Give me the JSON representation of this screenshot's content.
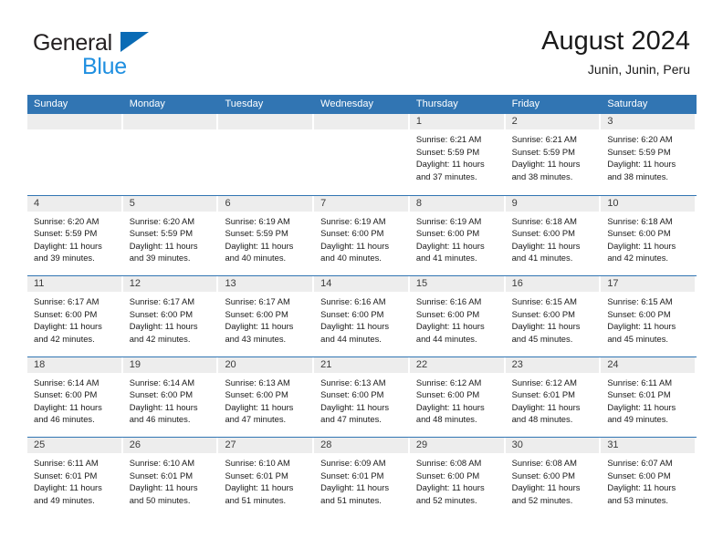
{
  "brand": {
    "name_part1": "General",
    "name_part2": "Blue",
    "logo_icon": "triangle-logo-icon"
  },
  "header": {
    "title": "August 2024",
    "subtitle": "Junin, Junin, Peru"
  },
  "colors": {
    "header_blue": "#3175b3",
    "brand_blue": "#1f8fe0",
    "logo_blue": "#0a6bb5",
    "day_band_gray": "#ededed"
  },
  "calendar": {
    "day_headers": [
      "Sunday",
      "Monday",
      "Tuesday",
      "Wednesday",
      "Thursday",
      "Friday",
      "Saturday"
    ],
    "weeks": [
      [
        {
          "day": "",
          "empty": true
        },
        {
          "day": "",
          "empty": true
        },
        {
          "day": "",
          "empty": true
        },
        {
          "day": "",
          "empty": true
        },
        {
          "day": "1",
          "sunrise": "Sunrise: 6:21 AM",
          "sunset": "Sunset: 5:59 PM",
          "daylight_line1": "Daylight: 11 hours",
          "daylight_line2": "and 37 minutes."
        },
        {
          "day": "2",
          "sunrise": "Sunrise: 6:21 AM",
          "sunset": "Sunset: 5:59 PM",
          "daylight_line1": "Daylight: 11 hours",
          "daylight_line2": "and 38 minutes."
        },
        {
          "day": "3",
          "sunrise": "Sunrise: 6:20 AM",
          "sunset": "Sunset: 5:59 PM",
          "daylight_line1": "Daylight: 11 hours",
          "daylight_line2": "and 38 minutes."
        }
      ],
      [
        {
          "day": "4",
          "sunrise": "Sunrise: 6:20 AM",
          "sunset": "Sunset: 5:59 PM",
          "daylight_line1": "Daylight: 11 hours",
          "daylight_line2": "and 39 minutes."
        },
        {
          "day": "5",
          "sunrise": "Sunrise: 6:20 AM",
          "sunset": "Sunset: 5:59 PM",
          "daylight_line1": "Daylight: 11 hours",
          "daylight_line2": "and 39 minutes."
        },
        {
          "day": "6",
          "sunrise": "Sunrise: 6:19 AM",
          "sunset": "Sunset: 5:59 PM",
          "daylight_line1": "Daylight: 11 hours",
          "daylight_line2": "and 40 minutes."
        },
        {
          "day": "7",
          "sunrise": "Sunrise: 6:19 AM",
          "sunset": "Sunset: 6:00 PM",
          "daylight_line1": "Daylight: 11 hours",
          "daylight_line2": "and 40 minutes."
        },
        {
          "day": "8",
          "sunrise": "Sunrise: 6:19 AM",
          "sunset": "Sunset: 6:00 PM",
          "daylight_line1": "Daylight: 11 hours",
          "daylight_line2": "and 41 minutes."
        },
        {
          "day": "9",
          "sunrise": "Sunrise: 6:18 AM",
          "sunset": "Sunset: 6:00 PM",
          "daylight_line1": "Daylight: 11 hours",
          "daylight_line2": "and 41 minutes."
        },
        {
          "day": "10",
          "sunrise": "Sunrise: 6:18 AM",
          "sunset": "Sunset: 6:00 PM",
          "daylight_line1": "Daylight: 11 hours",
          "daylight_line2": "and 42 minutes."
        }
      ],
      [
        {
          "day": "11",
          "sunrise": "Sunrise: 6:17 AM",
          "sunset": "Sunset: 6:00 PM",
          "daylight_line1": "Daylight: 11 hours",
          "daylight_line2": "and 42 minutes."
        },
        {
          "day": "12",
          "sunrise": "Sunrise: 6:17 AM",
          "sunset": "Sunset: 6:00 PM",
          "daylight_line1": "Daylight: 11 hours",
          "daylight_line2": "and 42 minutes."
        },
        {
          "day": "13",
          "sunrise": "Sunrise: 6:17 AM",
          "sunset": "Sunset: 6:00 PM",
          "daylight_line1": "Daylight: 11 hours",
          "daylight_line2": "and 43 minutes."
        },
        {
          "day": "14",
          "sunrise": "Sunrise: 6:16 AM",
          "sunset": "Sunset: 6:00 PM",
          "daylight_line1": "Daylight: 11 hours",
          "daylight_line2": "and 44 minutes."
        },
        {
          "day": "15",
          "sunrise": "Sunrise: 6:16 AM",
          "sunset": "Sunset: 6:00 PM",
          "daylight_line1": "Daylight: 11 hours",
          "daylight_line2": "and 44 minutes."
        },
        {
          "day": "16",
          "sunrise": "Sunrise: 6:15 AM",
          "sunset": "Sunset: 6:00 PM",
          "daylight_line1": "Daylight: 11 hours",
          "daylight_line2": "and 45 minutes."
        },
        {
          "day": "17",
          "sunrise": "Sunrise: 6:15 AM",
          "sunset": "Sunset: 6:00 PM",
          "daylight_line1": "Daylight: 11 hours",
          "daylight_line2": "and 45 minutes."
        }
      ],
      [
        {
          "day": "18",
          "sunrise": "Sunrise: 6:14 AM",
          "sunset": "Sunset: 6:00 PM",
          "daylight_line1": "Daylight: 11 hours",
          "daylight_line2": "and 46 minutes."
        },
        {
          "day": "19",
          "sunrise": "Sunrise: 6:14 AM",
          "sunset": "Sunset: 6:00 PM",
          "daylight_line1": "Daylight: 11 hours",
          "daylight_line2": "and 46 minutes."
        },
        {
          "day": "20",
          "sunrise": "Sunrise: 6:13 AM",
          "sunset": "Sunset: 6:00 PM",
          "daylight_line1": "Daylight: 11 hours",
          "daylight_line2": "and 47 minutes."
        },
        {
          "day": "21",
          "sunrise": "Sunrise: 6:13 AM",
          "sunset": "Sunset: 6:00 PM",
          "daylight_line1": "Daylight: 11 hours",
          "daylight_line2": "and 47 minutes."
        },
        {
          "day": "22",
          "sunrise": "Sunrise: 6:12 AM",
          "sunset": "Sunset: 6:00 PM",
          "daylight_line1": "Daylight: 11 hours",
          "daylight_line2": "and 48 minutes."
        },
        {
          "day": "23",
          "sunrise": "Sunrise: 6:12 AM",
          "sunset": "Sunset: 6:01 PM",
          "daylight_line1": "Daylight: 11 hours",
          "daylight_line2": "and 48 minutes."
        },
        {
          "day": "24",
          "sunrise": "Sunrise: 6:11 AM",
          "sunset": "Sunset: 6:01 PM",
          "daylight_line1": "Daylight: 11 hours",
          "daylight_line2": "and 49 minutes."
        }
      ],
      [
        {
          "day": "25",
          "sunrise": "Sunrise: 6:11 AM",
          "sunset": "Sunset: 6:01 PM",
          "daylight_line1": "Daylight: 11 hours",
          "daylight_line2": "and 49 minutes."
        },
        {
          "day": "26",
          "sunrise": "Sunrise: 6:10 AM",
          "sunset": "Sunset: 6:01 PM",
          "daylight_line1": "Daylight: 11 hours",
          "daylight_line2": "and 50 minutes."
        },
        {
          "day": "27",
          "sunrise": "Sunrise: 6:10 AM",
          "sunset": "Sunset: 6:01 PM",
          "daylight_line1": "Daylight: 11 hours",
          "daylight_line2": "and 51 minutes."
        },
        {
          "day": "28",
          "sunrise": "Sunrise: 6:09 AM",
          "sunset": "Sunset: 6:01 PM",
          "daylight_line1": "Daylight: 11 hours",
          "daylight_line2": "and 51 minutes."
        },
        {
          "day": "29",
          "sunrise": "Sunrise: 6:08 AM",
          "sunset": "Sunset: 6:00 PM",
          "daylight_line1": "Daylight: 11 hours",
          "daylight_line2": "and 52 minutes."
        },
        {
          "day": "30",
          "sunrise": "Sunrise: 6:08 AM",
          "sunset": "Sunset: 6:00 PM",
          "daylight_line1": "Daylight: 11 hours",
          "daylight_line2": "and 52 minutes."
        },
        {
          "day": "31",
          "sunrise": "Sunrise: 6:07 AM",
          "sunset": "Sunset: 6:00 PM",
          "daylight_line1": "Daylight: 11 hours",
          "daylight_line2": "and 53 minutes."
        }
      ]
    ]
  }
}
